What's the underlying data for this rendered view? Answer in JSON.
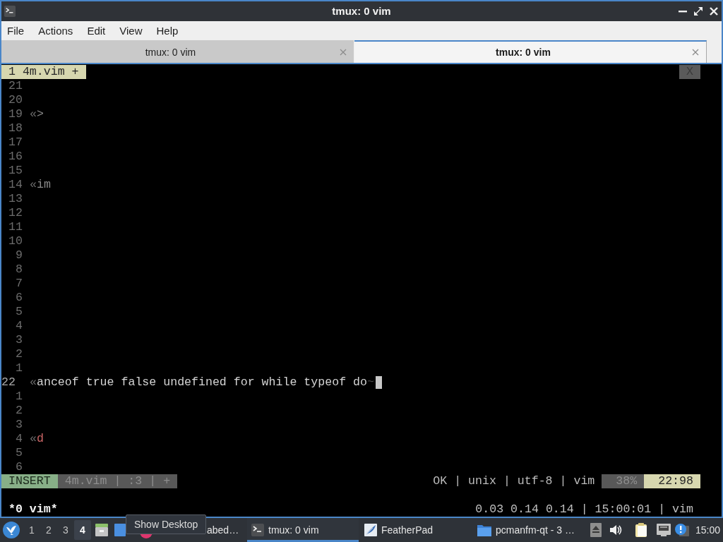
{
  "window": {
    "title": "tmux: 0 vim"
  },
  "menu_bar": [
    "File",
    "Actions",
    "Edit",
    "View",
    "Help"
  ],
  "tabs": [
    {
      "label": "tmux: 0 vim",
      "selected": false
    },
    {
      "label": "tmux: 0 vim",
      "selected": true
    }
  ],
  "vim": {
    "tabline": {
      "tabs": [
        {
          "label": "1 4m.vim +",
          "selected": true
        }
      ],
      "close": "X"
    },
    "lines": [
      {
        "number": "21",
        "kind": "plain"
      },
      {
        "number": "20",
        "kind": "plain"
      },
      {
        "number": "19",
        "kind": "dim",
        "marker": "«",
        "text": ">"
      },
      {
        "number": "18",
        "kind": "plain"
      },
      {
        "number": "17",
        "kind": "plain"
      },
      {
        "number": "16",
        "kind": "plain"
      },
      {
        "number": "15",
        "kind": "plain"
      },
      {
        "number": "14",
        "kind": "dim",
        "marker": "«",
        "text": "im"
      },
      {
        "number": "13",
        "kind": "plain"
      },
      {
        "number": "12",
        "kind": "plain"
      },
      {
        "number": "11",
        "kind": "plain"
      },
      {
        "number": "10",
        "kind": "plain"
      },
      {
        "number": "9",
        "kind": "plain"
      },
      {
        "number": "8",
        "kind": "plain"
      },
      {
        "number": "7",
        "kind": "plain"
      },
      {
        "number": "6",
        "kind": "plain"
      },
      {
        "number": "5",
        "kind": "plain"
      },
      {
        "number": "4",
        "kind": "plain"
      },
      {
        "number": "3",
        "kind": "plain"
      },
      {
        "number": "2",
        "kind": "plain"
      },
      {
        "number": "1",
        "kind": "plain"
      },
      {
        "number": "22",
        "kind": "current",
        "marker": "«",
        "text": "anceof true false undefined for while typeof do",
        "eol": "~",
        "cursor": true
      },
      {
        "number": "1",
        "kind": "plain"
      },
      {
        "number": "2",
        "kind": "plain"
      },
      {
        "number": "3",
        "kind": "plain"
      },
      {
        "number": "4",
        "kind": "accent",
        "marker": "«",
        "text": "d"
      },
      {
        "number": "5",
        "kind": "plain"
      },
      {
        "number": "6",
        "kind": "plain"
      }
    ],
    "statusline": {
      "mode": "INSERT",
      "file_info": "4m.vim | :3 | +",
      "file_format": "OK | unix | utf-8 | vim",
      "percent": "38%",
      "position": "22:98"
    }
  },
  "tmux_status": {
    "window": "*0 vim*",
    "right": "0.03 0.14 0.14 | 15:00:01 | vim"
  },
  "taskbar": {
    "desktops": [
      {
        "label": "1",
        "selected": false
      },
      {
        "label": "2",
        "selected": false
      },
      {
        "label": "3",
        "selected": false
      },
      {
        "label": "4",
        "selected": true
      }
    ],
    "tooltip": "Show Desktop",
    "tasks": [
      {
        "label": "abed…",
        "kind": "app",
        "selected": false
      },
      {
        "label": "tmux: 0 vim",
        "kind": "terminal",
        "selected": true
      },
      {
        "label": "FeatherPad",
        "kind": "editor",
        "selected": false
      },
      {
        "label": "pcmanfm-qt - 3 …",
        "kind": "files",
        "selected": false
      }
    ],
    "clock": "15:00"
  }
}
